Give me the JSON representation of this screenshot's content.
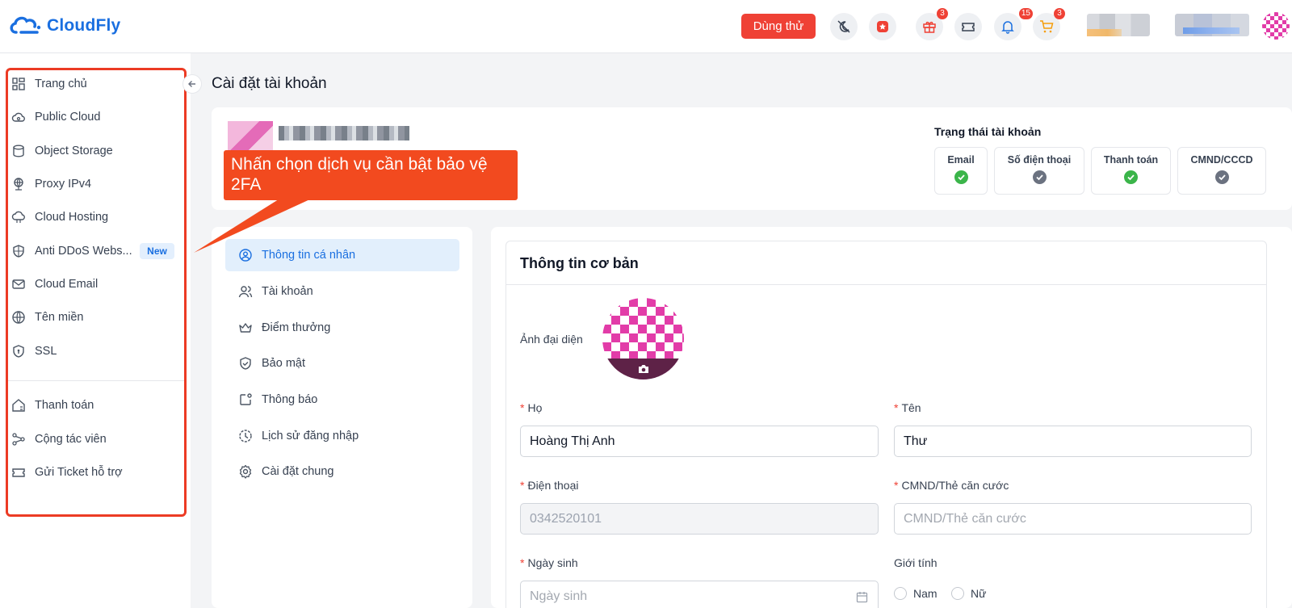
{
  "header": {
    "brand": "CloudFly",
    "try_label": "Dùng thử",
    "gift_count": "3",
    "notification_count": "15",
    "cart_count": "3"
  },
  "sidebar": {
    "items": [
      {
        "label": "Trang chủ",
        "icon": "dashboard-icon"
      },
      {
        "label": "Public Cloud",
        "icon": "cloud-icon"
      },
      {
        "label": "Object Storage",
        "icon": "storage-icon"
      },
      {
        "label": "Proxy IPv4",
        "icon": "proxy-icon"
      },
      {
        "label": "Cloud Hosting",
        "icon": "hosting-icon"
      },
      {
        "label": "Anti DDoS Webs...",
        "icon": "shield-icon"
      },
      {
        "label": "Cloud Email",
        "icon": "mail-icon"
      },
      {
        "label": "Tên miền",
        "icon": "globe-icon"
      },
      {
        "label": "SSL",
        "icon": "ssl-icon"
      },
      {
        "label": "Thanh toán",
        "icon": "billing-icon"
      },
      {
        "label": "Cộng tác viên",
        "icon": "affiliate-icon"
      },
      {
        "label": "Gửi Ticket hỗ trợ",
        "icon": "ticket-icon"
      }
    ],
    "new_badge": "New"
  },
  "page": {
    "title": "Cài đặt tài khoản"
  },
  "status": {
    "title": "Trạng thái tài khoản",
    "items": [
      {
        "label": "Email",
        "state": "verified"
      },
      {
        "label": "Số điện thoại",
        "state": "pending"
      },
      {
        "label": "Thanh toán",
        "state": "verified"
      },
      {
        "label": "CMND/CCCD",
        "state": "pending"
      }
    ],
    "colors": {
      "verified": "#3bb54a",
      "pending": "#6b7280"
    }
  },
  "callout": {
    "text": "Nhấn chọn dịch vụ cần bật bảo vệ 2FA"
  },
  "account_menu": {
    "items": [
      {
        "label": "Thông tin cá nhân",
        "icon": "user-circle-icon",
        "active": true
      },
      {
        "label": "Tài khoản",
        "icon": "users-icon",
        "active": false
      },
      {
        "label": "Điểm thưởng",
        "icon": "crown-icon",
        "active": false
      },
      {
        "label": "Bảo mật",
        "icon": "shield-check-icon",
        "active": false
      },
      {
        "label": "Thông báo",
        "icon": "notification-icon",
        "active": false
      },
      {
        "label": "Lịch sử đăng nhập",
        "icon": "history-icon",
        "active": false
      },
      {
        "label": "Cài đặt chung",
        "icon": "settings-icon",
        "active": false
      }
    ]
  },
  "form": {
    "title": "Thông tin cơ bản",
    "avatar_label": "Ảnh đại diện",
    "last_name": {
      "label": "Họ",
      "value": "Hoàng Thị Anh"
    },
    "first_name": {
      "label": "Tên",
      "value": "Thư"
    },
    "phone": {
      "label": "Điện thoại",
      "value": "0342520101"
    },
    "id_card": {
      "label": "CMND/Thẻ căn cước",
      "placeholder": "CMND/Thẻ căn cước"
    },
    "birthday": {
      "label": "Ngày sinh",
      "placeholder": "Ngày sinh"
    },
    "gender": {
      "label": "Giới tính",
      "options": [
        "Nam",
        "Nữ"
      ]
    }
  },
  "colors": {
    "brand": "#1a6fe0",
    "accent": "#ef4135",
    "highlight": "#ec3b24"
  }
}
